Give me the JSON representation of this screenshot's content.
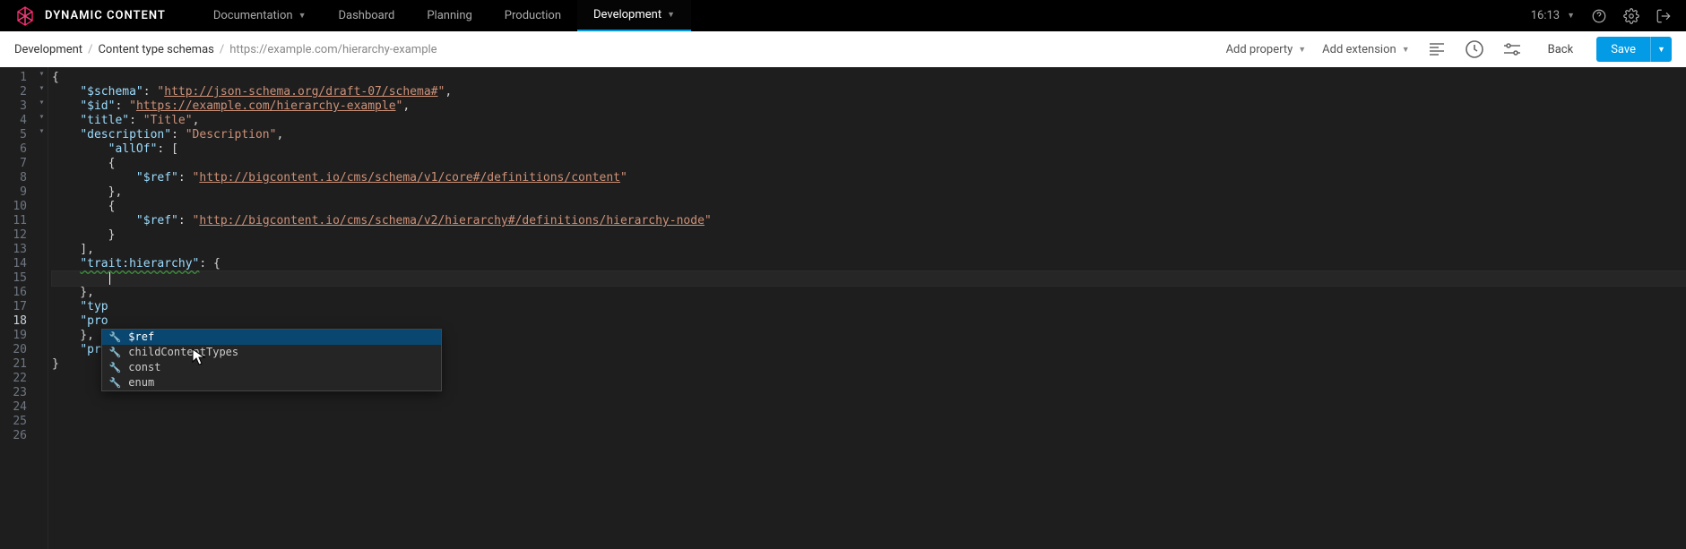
{
  "header": {
    "brand": "DYNAMIC CONTENT",
    "tabs": [
      {
        "label": "Documentation",
        "has_dropdown": true
      },
      {
        "label": "Dashboard",
        "has_dropdown": false
      },
      {
        "label": "Planning",
        "has_dropdown": false
      },
      {
        "label": "Production",
        "has_dropdown": false
      },
      {
        "label": "Development",
        "has_dropdown": true,
        "active": true
      }
    ],
    "clock": "16:13"
  },
  "subheader": {
    "breadcrumb": [
      {
        "label": "Development",
        "muted": false
      },
      {
        "label": "Content type schemas",
        "muted": false
      },
      {
        "label": "https://example.com/hierarchy-example",
        "muted": true
      }
    ],
    "add_property": "Add property",
    "add_extension": "Add extension",
    "back": "Back",
    "save": "Save"
  },
  "editor": {
    "current_line": 18,
    "lines": [
      {
        "n": 1,
        "segs": [
          {
            "t": "{",
            "c": "punc"
          }
        ]
      },
      {
        "n": 2,
        "segs": [
          {
            "t": "    ",
            "c": "punc"
          },
          {
            "t": "\"$schema\"",
            "c": "key"
          },
          {
            "t": ": ",
            "c": "punc"
          },
          {
            "t": "\"",
            "c": "str"
          },
          {
            "t": "http://json-schema.org/draft-07/schema#",
            "c": "link"
          },
          {
            "t": "\"",
            "c": "str"
          },
          {
            "t": ",",
            "c": "punc"
          }
        ]
      },
      {
        "n": 3,
        "segs": [
          {
            "t": "    ",
            "c": "punc"
          },
          {
            "t": "\"$id\"",
            "c": "key"
          },
          {
            "t": ": ",
            "c": "punc"
          },
          {
            "t": "\"",
            "c": "str"
          },
          {
            "t": "https://example.com/hierarchy-example",
            "c": "link"
          },
          {
            "t": "\"",
            "c": "str"
          },
          {
            "t": ",",
            "c": "punc"
          }
        ]
      },
      {
        "n": 4,
        "segs": []
      },
      {
        "n": 5,
        "segs": [
          {
            "t": "    ",
            "c": "punc"
          },
          {
            "t": "\"title\"",
            "c": "key"
          },
          {
            "t": ": ",
            "c": "punc"
          },
          {
            "t": "\"Title\"",
            "c": "str"
          },
          {
            "t": ",",
            "c": "punc"
          }
        ]
      },
      {
        "n": 6,
        "segs": [
          {
            "t": "    ",
            "c": "punc"
          },
          {
            "t": "\"description\"",
            "c": "key"
          },
          {
            "t": ": ",
            "c": "punc"
          },
          {
            "t": "\"Description\"",
            "c": "str"
          },
          {
            "t": ",",
            "c": "punc"
          }
        ]
      },
      {
        "n": 7,
        "segs": []
      },
      {
        "n": 8,
        "segs": [
          {
            "t": "        ",
            "c": "punc"
          },
          {
            "t": "\"allOf\"",
            "c": "key"
          },
          {
            "t": ": [",
            "c": "punc"
          }
        ]
      },
      {
        "n": 9,
        "segs": [
          {
            "t": "        {",
            "c": "punc"
          }
        ]
      },
      {
        "n": 10,
        "segs": [
          {
            "t": "            ",
            "c": "punc"
          },
          {
            "t": "\"$ref\"",
            "c": "key"
          },
          {
            "t": ": ",
            "c": "punc"
          },
          {
            "t": "\"",
            "c": "str"
          },
          {
            "t": "http://bigcontent.io/cms/schema/v1/core#/definitions/content",
            "c": "link"
          },
          {
            "t": "\"",
            "c": "str"
          }
        ]
      },
      {
        "n": 11,
        "segs": [
          {
            "t": "        },",
            "c": "punc"
          }
        ]
      },
      {
        "n": 12,
        "segs": [
          {
            "t": "        {",
            "c": "punc"
          }
        ]
      },
      {
        "n": 13,
        "segs": [
          {
            "t": "            ",
            "c": "punc"
          },
          {
            "t": "\"$ref\"",
            "c": "key"
          },
          {
            "t": ": ",
            "c": "punc"
          },
          {
            "t": "\"",
            "c": "str"
          },
          {
            "t": "http://bigcontent.io/cms/schema/v2/hierarchy#/definitions/hierarchy-node",
            "c": "link"
          },
          {
            "t": "\"",
            "c": "str"
          }
        ]
      },
      {
        "n": 14,
        "segs": [
          {
            "t": "        }",
            "c": "punc"
          }
        ]
      },
      {
        "n": 15,
        "segs": [
          {
            "t": "    ],",
            "c": "punc"
          }
        ]
      },
      {
        "n": 16,
        "segs": []
      },
      {
        "n": 17,
        "segs": [
          {
            "t": "    ",
            "c": "punc"
          },
          {
            "t": "\"trait:hierarchy\"",
            "c": "key",
            "squiggle": true
          },
          {
            "t": ": {",
            "c": "punc"
          }
        ]
      },
      {
        "n": 18,
        "segs": [
          {
            "t": "        ",
            "c": "punc"
          }
        ],
        "caret": true
      },
      {
        "n": 19,
        "segs": [
          {
            "t": "    },",
            "c": "punc"
          }
        ]
      },
      {
        "n": 20,
        "segs": []
      },
      {
        "n": 21,
        "segs": [
          {
            "t": "    ",
            "c": "punc"
          },
          {
            "t": "\"typ",
            "c": "key"
          }
        ]
      },
      {
        "n": 22,
        "segs": [
          {
            "t": "    ",
            "c": "punc"
          },
          {
            "t": "\"pro",
            "c": "key"
          }
        ]
      },
      {
        "n": 23,
        "segs": []
      },
      {
        "n": 24,
        "segs": [
          {
            "t": "    },",
            "c": "punc"
          }
        ]
      },
      {
        "n": 25,
        "segs": [
          {
            "t": "    ",
            "c": "punc"
          },
          {
            "t": "\"propertyorder\"",
            "c": "key"
          },
          {
            "t": ": []",
            "c": "punc"
          }
        ]
      },
      {
        "n": 26,
        "segs": [
          {
            "t": "}",
            "c": "punc"
          }
        ]
      }
    ]
  },
  "suggest": {
    "items": [
      {
        "label": "$ref",
        "selected": true
      },
      {
        "label": "childContentTypes",
        "selected": false
      },
      {
        "label": "const",
        "selected": false
      },
      {
        "label": "enum",
        "selected": false
      }
    ]
  }
}
